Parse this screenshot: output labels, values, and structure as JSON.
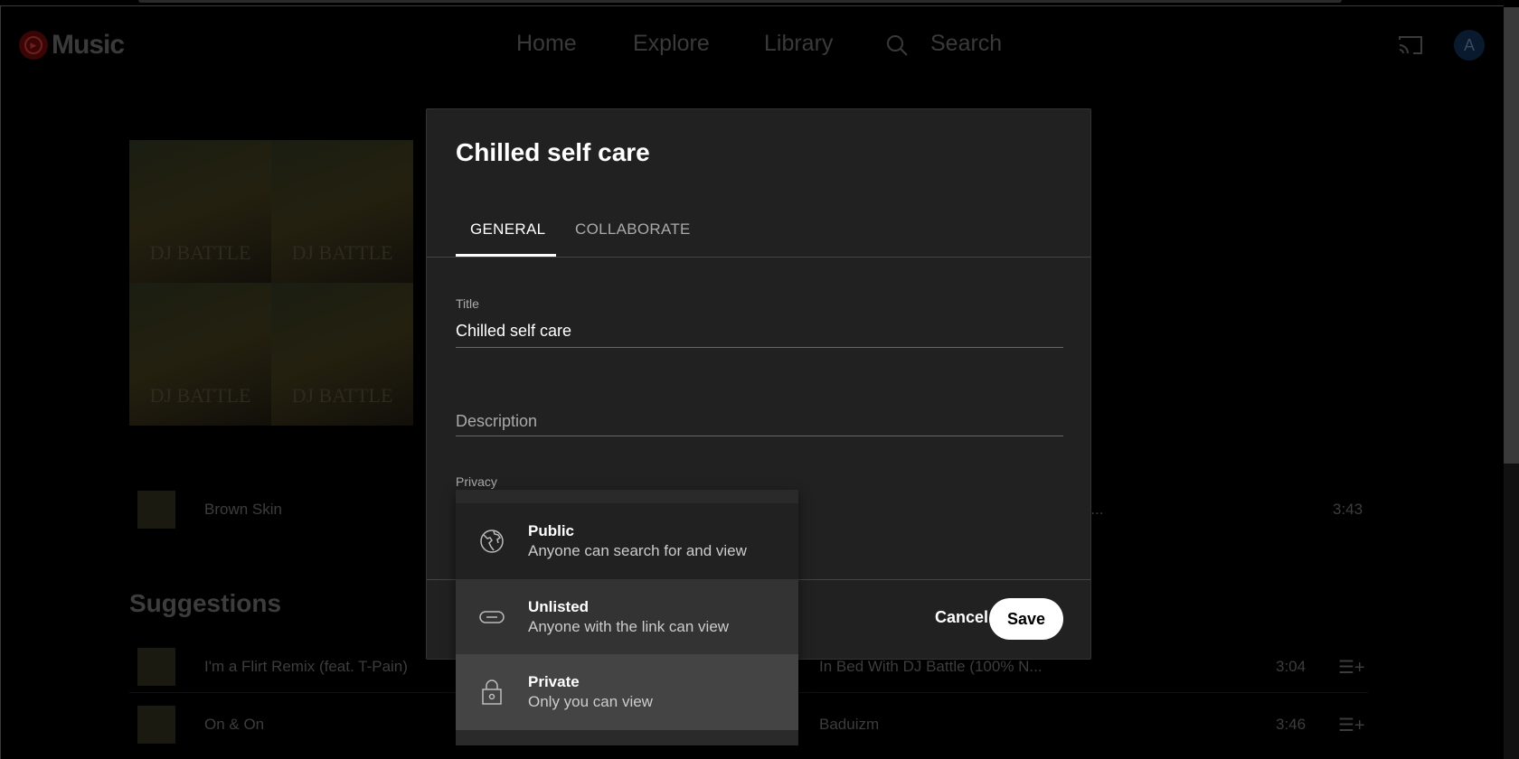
{
  "header": {
    "logo_text": "Music",
    "nav": [
      "Home",
      "Explore",
      "Library"
    ],
    "search_label": "Search",
    "avatar_initial": "A"
  },
  "playlist": {
    "art_text": "DJ BATTLE",
    "tracks": [
      {
        "title": "Brown Skin",
        "album": "w...",
        "duration": "3:43"
      }
    ]
  },
  "suggestions": {
    "heading": "Suggestions",
    "items": [
      {
        "title": "I'm a Flirt Remix (feat. T-Pain)",
        "album": "In Bed With DJ Battle (100% N...",
        "duration": "3:04"
      },
      {
        "title": "On & On",
        "album": "Baduizm",
        "duration": "3:46"
      }
    ]
  },
  "dialog": {
    "title": "Chilled self care",
    "tabs": [
      {
        "label": "GENERAL",
        "active": true
      },
      {
        "label": "COLLABORATE",
        "active": false
      }
    ],
    "title_label": "Title",
    "title_value": "Chilled self care",
    "description_placeholder": "Description",
    "privacy_label": "Privacy",
    "privacy_options": [
      {
        "icon": "globe-icon",
        "label": "Public",
        "desc": "Anyone can search for and view"
      },
      {
        "icon": "link-icon",
        "label": "Unlisted",
        "desc": "Anyone with the link can view"
      },
      {
        "icon": "lock-icon",
        "label": "Private",
        "desc": "Only you can view",
        "selected": true
      }
    ],
    "cancel": "Cancel",
    "save": "Save"
  }
}
